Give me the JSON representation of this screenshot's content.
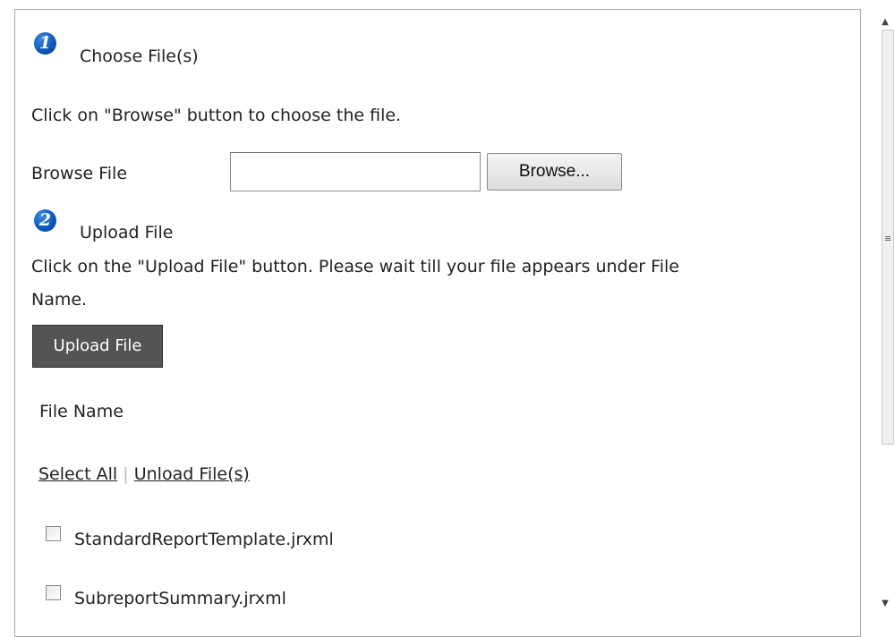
{
  "step1": {
    "number": "1",
    "title": "Choose File(s)",
    "instruction": "Click on \"Browse\" button to choose the file.",
    "browse_label": "Browse File",
    "file_input_value": "",
    "browse_button": "Browse..."
  },
  "step2": {
    "number": "2",
    "title": "Upload File",
    "instruction_line1": "Click on the \"Upload File\" button. Please wait till your file appears under File",
    "instruction_line2": "Name.",
    "upload_button": "Upload File"
  },
  "files": {
    "header": "File Name",
    "select_all": "Select All",
    "separator": "|",
    "unload": "Unload File(s)",
    "items": [
      {
        "name": "StandardReportTemplate.jrxml",
        "checked": false
      },
      {
        "name": "SubreportSummary.jrxml",
        "checked": false
      }
    ]
  },
  "scrollbar": {
    "up_icon": "▲",
    "down_icon": "▼"
  }
}
